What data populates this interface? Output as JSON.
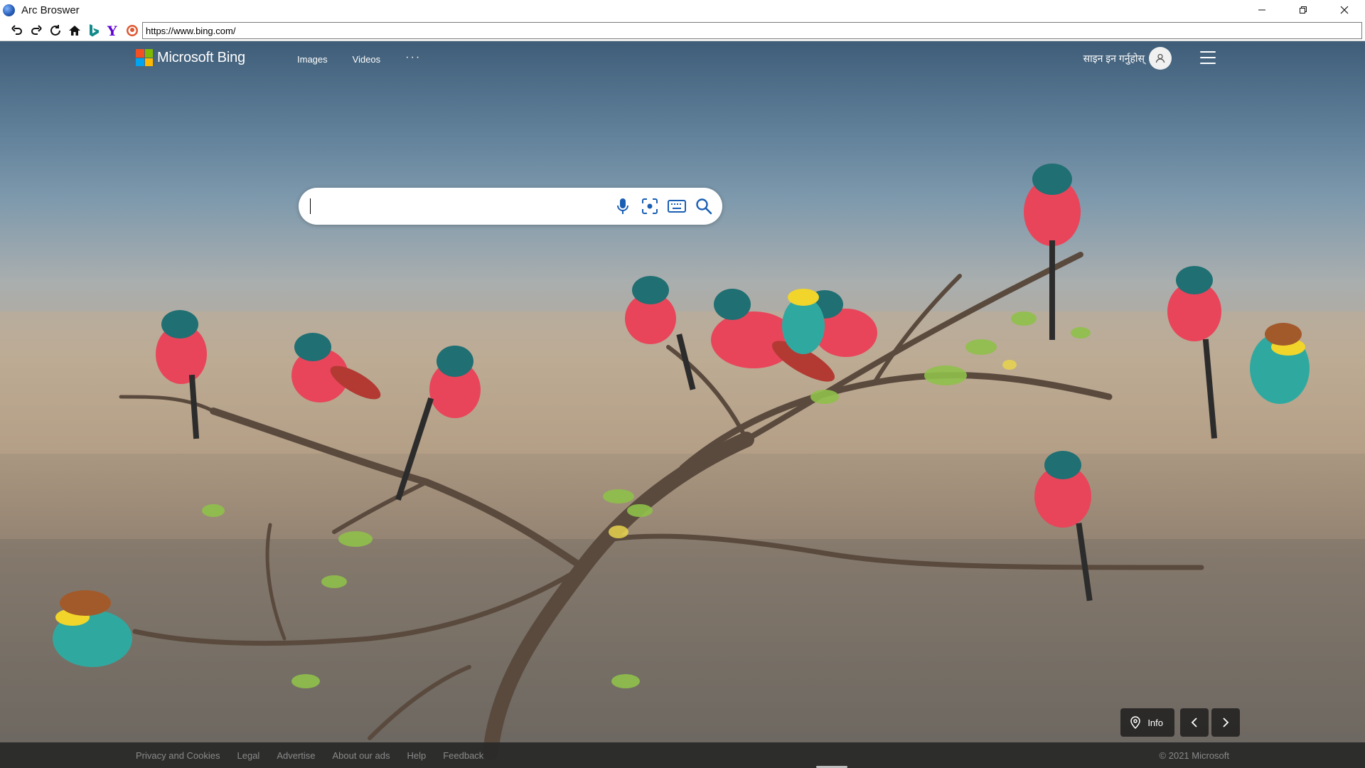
{
  "window": {
    "title": "Arc Broswer",
    "controls": [
      "minimize-icon",
      "restore-icon",
      "close-icon"
    ]
  },
  "toolbar": {
    "buttons": [
      "undo-icon",
      "redo-icon",
      "reload-icon",
      "home-icon",
      "bing-icon",
      "yahoo-icon",
      "duckduckgo-icon"
    ],
    "address": "https://www.bing.com/"
  },
  "header": {
    "logo_text": "Microsoft Bing",
    "nav": [
      "Images",
      "Videos"
    ],
    "more": "···",
    "signin": "साइन इन गर्नुहोस्"
  },
  "search": {
    "value": "",
    "icons": [
      "microphone-icon",
      "visual-search-icon",
      "keyboard-icon",
      "search-icon"
    ]
  },
  "image_controls": {
    "info_label": "Info"
  },
  "footer": {
    "links": [
      "Privacy and Cookies",
      "Legal",
      "Advertise",
      "About our ads",
      "Help",
      "Feedback"
    ],
    "copyright": "© 2021 Microsoft"
  },
  "colors": {
    "ms_red": "#f25022",
    "ms_green": "#7fba00",
    "ms_blue": "#00a4ef",
    "ms_yellow": "#ffb900",
    "footer_bg": "#282828"
  }
}
